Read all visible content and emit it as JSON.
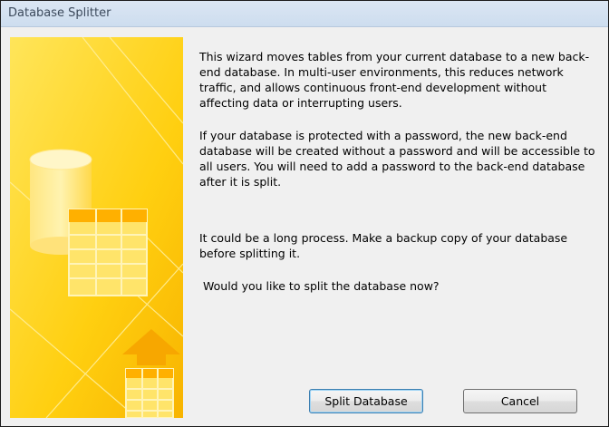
{
  "window": {
    "title": "Database Splitter"
  },
  "message": {
    "paragraph1": "This wizard moves tables from your current database to a new back-end database. In multi-user environments, this reduces network traffic, and allows continuous front-end development without affecting data or interrupting users.",
    "paragraph2": "If your database is protected with a password, the new back-end database will be created without a password and will be accessible to all users.  You will need to add a password to the back-end database after it is split.",
    "paragraph3": "It could be a long process. Make a backup copy of your database before splitting it.",
    "question": "Would you like to split the database now?"
  },
  "buttons": {
    "split_label": "Split Database",
    "cancel_label": "Cancel"
  },
  "colors": {
    "accent_yellow": "#ffd21a",
    "panel_orange": "#f5a800",
    "title_bar": "#d6e3f2"
  },
  "icons": {
    "illustration": "database-table-illustration-icon",
    "arrow": "arrow-up-icon"
  }
}
